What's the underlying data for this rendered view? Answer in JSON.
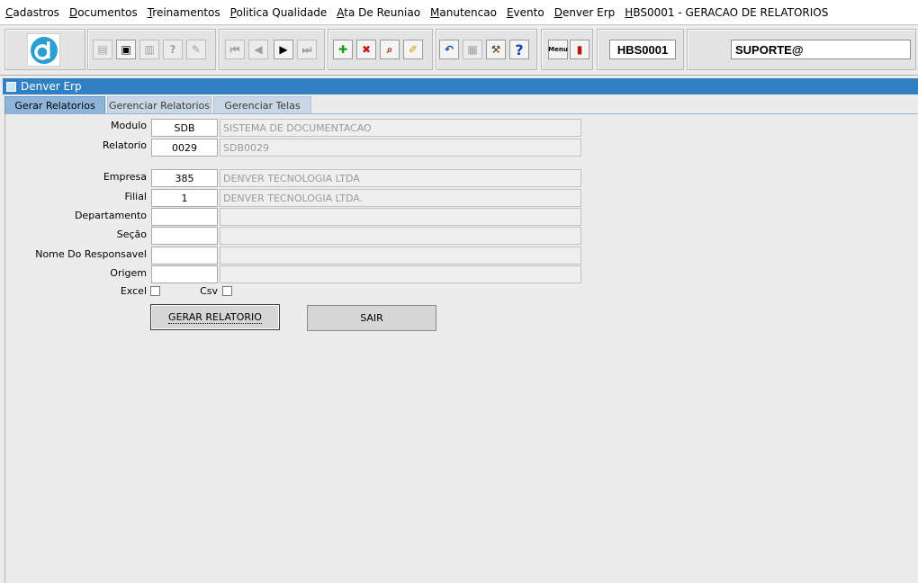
{
  "menu": [
    {
      "first": "C",
      "rest": "adastros"
    },
    {
      "first": "D",
      "rest": "ocumentos"
    },
    {
      "first": "T",
      "rest": "reinamentos"
    },
    {
      "first": "P",
      "rest": "olitica Qualidade"
    },
    {
      "first": "A",
      "rest": "ta De Reuniao"
    },
    {
      "first": "M",
      "rest": "anutencao"
    },
    {
      "first": "E",
      "rest": "vento"
    },
    {
      "first": "D",
      "rest": "enver Erp"
    },
    {
      "first": "H",
      "rest": "BS0001 - GERACAO DE RELATORIOS"
    }
  ],
  "toolbar": {
    "screen_code": "HBS0001",
    "user": "SUPORTE@",
    "icons": [
      "save-icon",
      "print-preview-icon",
      "print-icon",
      "help-query-icon",
      "edit-icon",
      "first-record-icon",
      "previous-record-icon",
      "next-record-icon",
      "last-record-icon",
      "add-icon",
      "delete-icon",
      "search-icon",
      "clear-icon",
      "undo-icon",
      "clipboard-icon",
      "tools-icon",
      "help-icon",
      "menu-icon",
      "exit-icon"
    ],
    "menu_icon_label": "Menu"
  },
  "window": {
    "title": "Denver Erp"
  },
  "tabs": [
    "Gerar Relatorios",
    "Gerenciar Relatorios",
    "Gerenciar Telas"
  ],
  "form": {
    "modulo_label": "Modulo",
    "modulo_code": "SDB",
    "modulo_desc": "SISTEMA DE DOCUMENTACAO",
    "relatorio_label": "Relatorio",
    "relatorio_code": "0029",
    "relatorio_desc": "SDB0029",
    "empresa_label": "Empresa",
    "empresa_code": "385",
    "empresa_desc": "DENVER TECNOLOGIA LTDA",
    "filial_label": "Filial",
    "filial_code": "1",
    "filial_desc": "DENVER TECNOLOGIA LTDA.",
    "departamento_label": "Departamento",
    "secao_label": "Seção",
    "responsavel_label": "Nome Do Responsavel",
    "origem_label": "Origem",
    "excel_label": "Excel",
    "csv_label": "Csv",
    "gerar_label": "GERAR RELATORIO",
    "sair_label": "SAIR"
  }
}
